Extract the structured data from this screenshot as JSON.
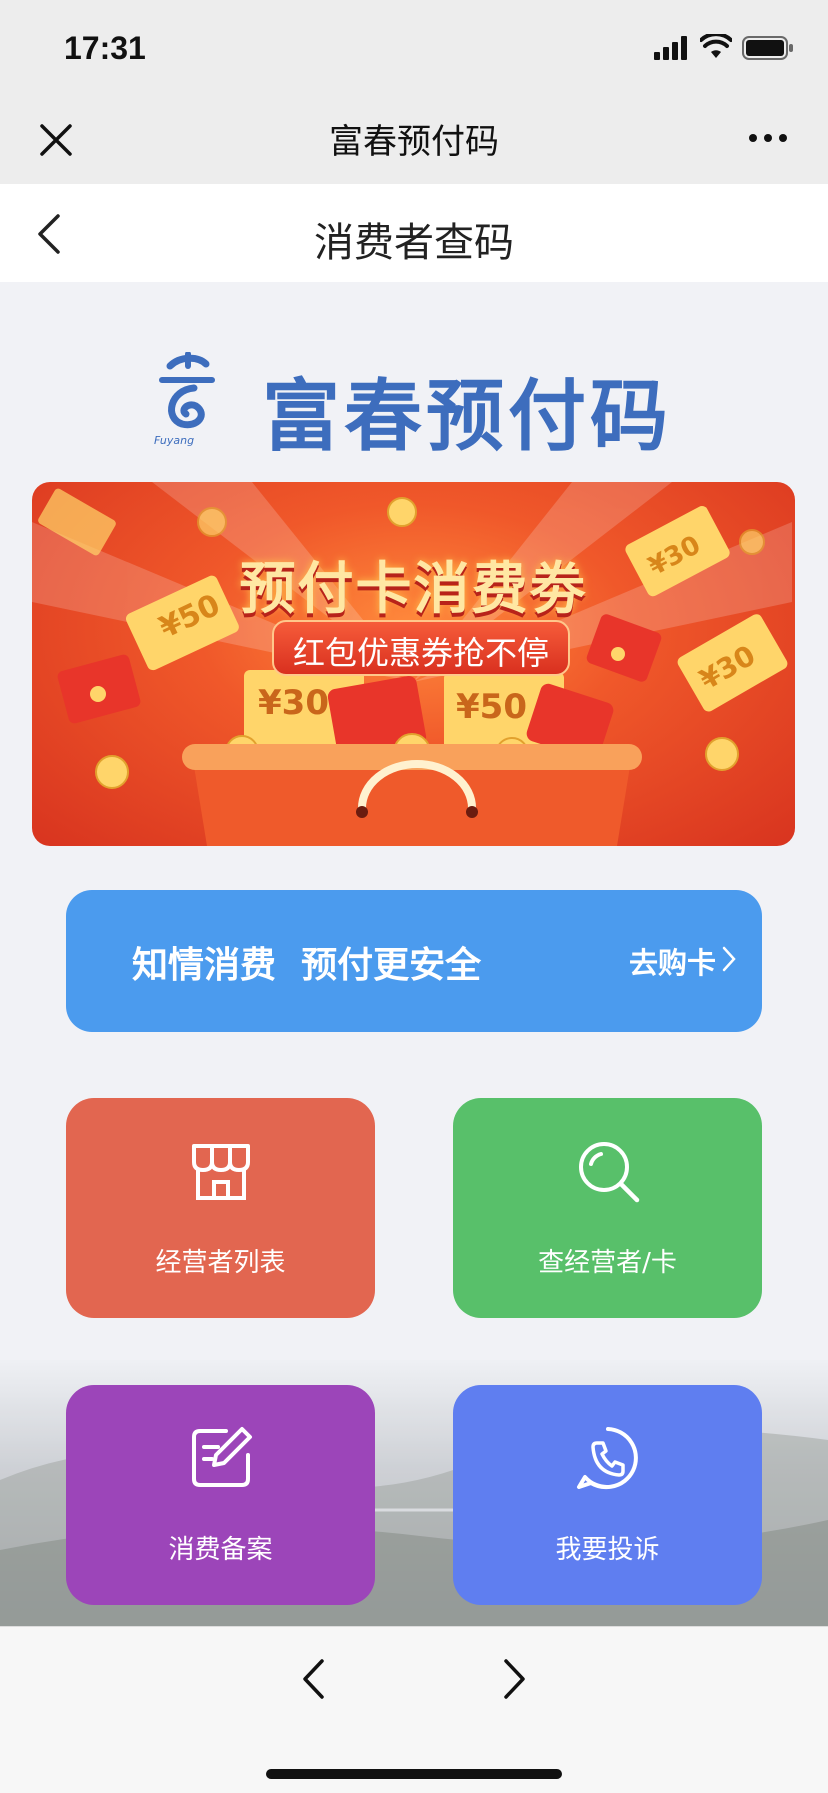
{
  "status": {
    "time": "17:31"
  },
  "nav": {
    "title": "富春预付码"
  },
  "header": {
    "title": "消费者查码"
  },
  "logo": {
    "text": "富春预付码",
    "emblem_text": "富阳"
  },
  "banner": {
    "title": "预付卡消费劵",
    "subtitle": "红包优惠券抢不停",
    "tickets": [
      "¥50",
      "¥30",
      "¥30",
      "¥30",
      "¥50"
    ]
  },
  "info_bar": {
    "text": "知情消费  预付更安全",
    "link_label": "去购卡"
  },
  "tiles": [
    {
      "label": "经营者列表",
      "icon": "store-icon",
      "color": "#e26650"
    },
    {
      "label": "查经营者/卡",
      "icon": "search-icon",
      "color": "#58c06a"
    },
    {
      "label": "消费备案",
      "icon": "edit-icon",
      "color": "#9c45b9"
    },
    {
      "label": "我要投诉",
      "icon": "phone-icon",
      "color": "#5f7ef0"
    }
  ]
}
